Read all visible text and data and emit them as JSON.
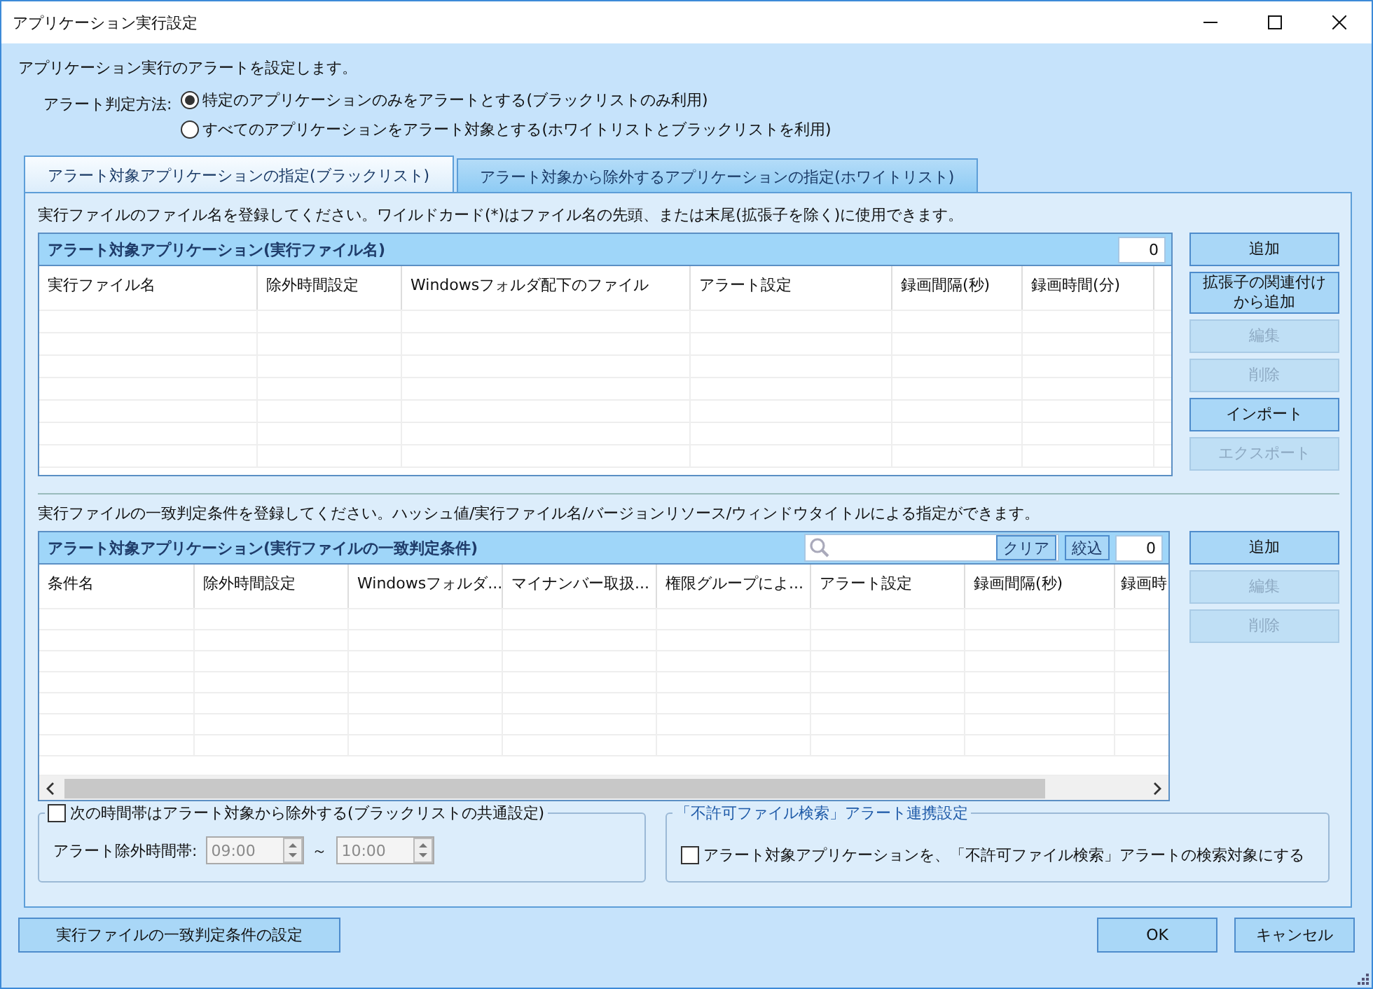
{
  "window": {
    "title": "アプリケーション実行設定"
  },
  "description": "アプリケーション実行のアラートを設定します。",
  "alert_method": {
    "label": "アラート判定方法:",
    "options": [
      {
        "label": "特定のアプリケーションのみをアラートとする(ブラックリストのみ利用)",
        "selected": true
      },
      {
        "label": "すべてのアプリケーションをアラート対象とする(ホワイトリストとブラックリストを利用)",
        "selected": false
      }
    ]
  },
  "tabs": [
    {
      "label": "アラート対象アプリケーションの指定(ブラックリスト)",
      "selected": true
    },
    {
      "label": "アラート対象から除外するアプリケーションの指定(ホワイトリスト)",
      "selected": false
    }
  ],
  "file_section": {
    "hint": "実行ファイルのファイル名を登録してください。ワイルドカード(*)はファイル名の先頭、または末尾(拡張子を除く)に使用できます。",
    "grid": {
      "title": "アラート対象アプリケーション(実行ファイル名)",
      "count": "0",
      "columns": [
        "実行ファイル名",
        "除外時間設定",
        "Windowsフォルダ配下のファイル",
        "アラート設定",
        "録画間隔(秒)",
        "録画時間(分)"
      ]
    },
    "buttons": [
      {
        "label": "追加",
        "disabled": false
      },
      {
        "label": "拡張子の関連付けから追加",
        "disabled": false
      },
      {
        "label": "編集",
        "disabled": true
      },
      {
        "label": "削除",
        "disabled": true
      },
      {
        "label": "インポート",
        "disabled": false
      },
      {
        "label": "エクスポート",
        "disabled": true
      }
    ]
  },
  "condition_section": {
    "hint": "実行ファイルの一致判定条件を登録してください。ハッシュ値/実行ファイル名/バージョンリソース/ウィンドウタイトルによる指定ができます。",
    "grid": {
      "title": "アラート対象アプリケーション(実行ファイルの一致判定条件)",
      "clear_button": "クリア",
      "filter_button": "絞込",
      "count": "0",
      "columns": [
        "条件名",
        "除外時間設定",
        "Windowsフォルダ...",
        "マイナンバー取扱...",
        "権限グループによ...",
        "アラート設定",
        "録画間隔(秒)",
        "録画時"
      ]
    },
    "buttons": [
      {
        "label": "追加",
        "disabled": false
      },
      {
        "label": "編集",
        "disabled": true
      },
      {
        "label": "削除",
        "disabled": true
      }
    ]
  },
  "exclusion": {
    "label": "次の時間帯はアラート対象から除外する(ブラックリストの共通設定)",
    "checked": false,
    "time_label": "アラート除外時間帯:",
    "from": "09:00",
    "separator": "～",
    "to": "10:00",
    "disabled": true
  },
  "file_search_link": {
    "legend": "「不許可ファイル検索」アラート連携設定",
    "label": "アラート対象アプリケーションを、「不許可ファイル検索」アラートの検索対象にする",
    "checked": false
  },
  "footer": {
    "conditions_button": "実行ファイルの一致判定条件の設定",
    "ok_button": "OK",
    "cancel_button": "キャンセル"
  }
}
